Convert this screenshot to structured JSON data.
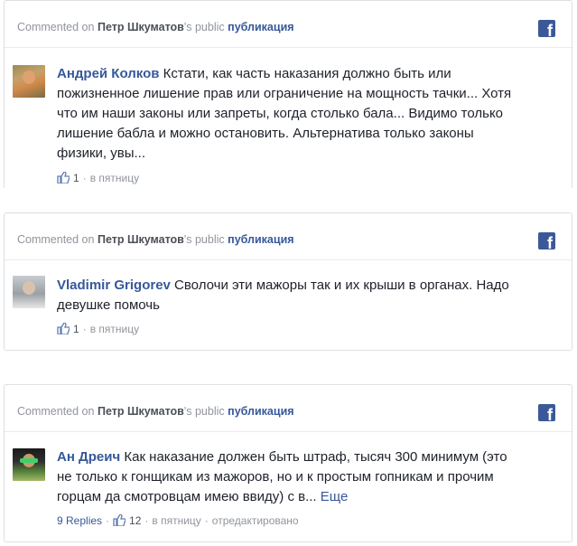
{
  "header": {
    "prefix": "Commented on",
    "owner": "Петр Шкуматов",
    "possessive": "'s public",
    "post_link": "публикация"
  },
  "colors": {
    "link": "#365899",
    "facebook_blue": "#3b5998",
    "meta_gray": "#90949c"
  },
  "icons": {
    "brand": "facebook-icon",
    "like": "thumbs-up-icon"
  },
  "comments": [
    {
      "author": "Андрей Колков",
      "text": "Кстати, как часть наказания должно быть или пожизненное лишение прав или ограничение на мощность тачки... Хотя что им наши законы или запреты, когда столько бала... Видимо только лишение бабла и можно остановить. Альтернатива только законы физики, увы...",
      "likes": "1",
      "separator": "·",
      "time": "в пятницу"
    },
    {
      "author": "Vladimir Grigorev",
      "text": "Сволочи эти мажоры так и их крыши в органах. Надо девушке помочь",
      "likes": "1",
      "separator": "·",
      "time": "в пятницу"
    },
    {
      "author": "Ан Дреич",
      "text": "Как наказание должен быть штраф, тысяч 300 минимум (это не только к гонщикам из мажоров, но и к простым гопникам и прочим горцам да смотровцам имею ввиду) с в...",
      "more": "Еще",
      "replies": "9 Replies",
      "likes": "12",
      "separator": "·",
      "time": "в пятницу",
      "edited": "отредактировано"
    }
  ]
}
